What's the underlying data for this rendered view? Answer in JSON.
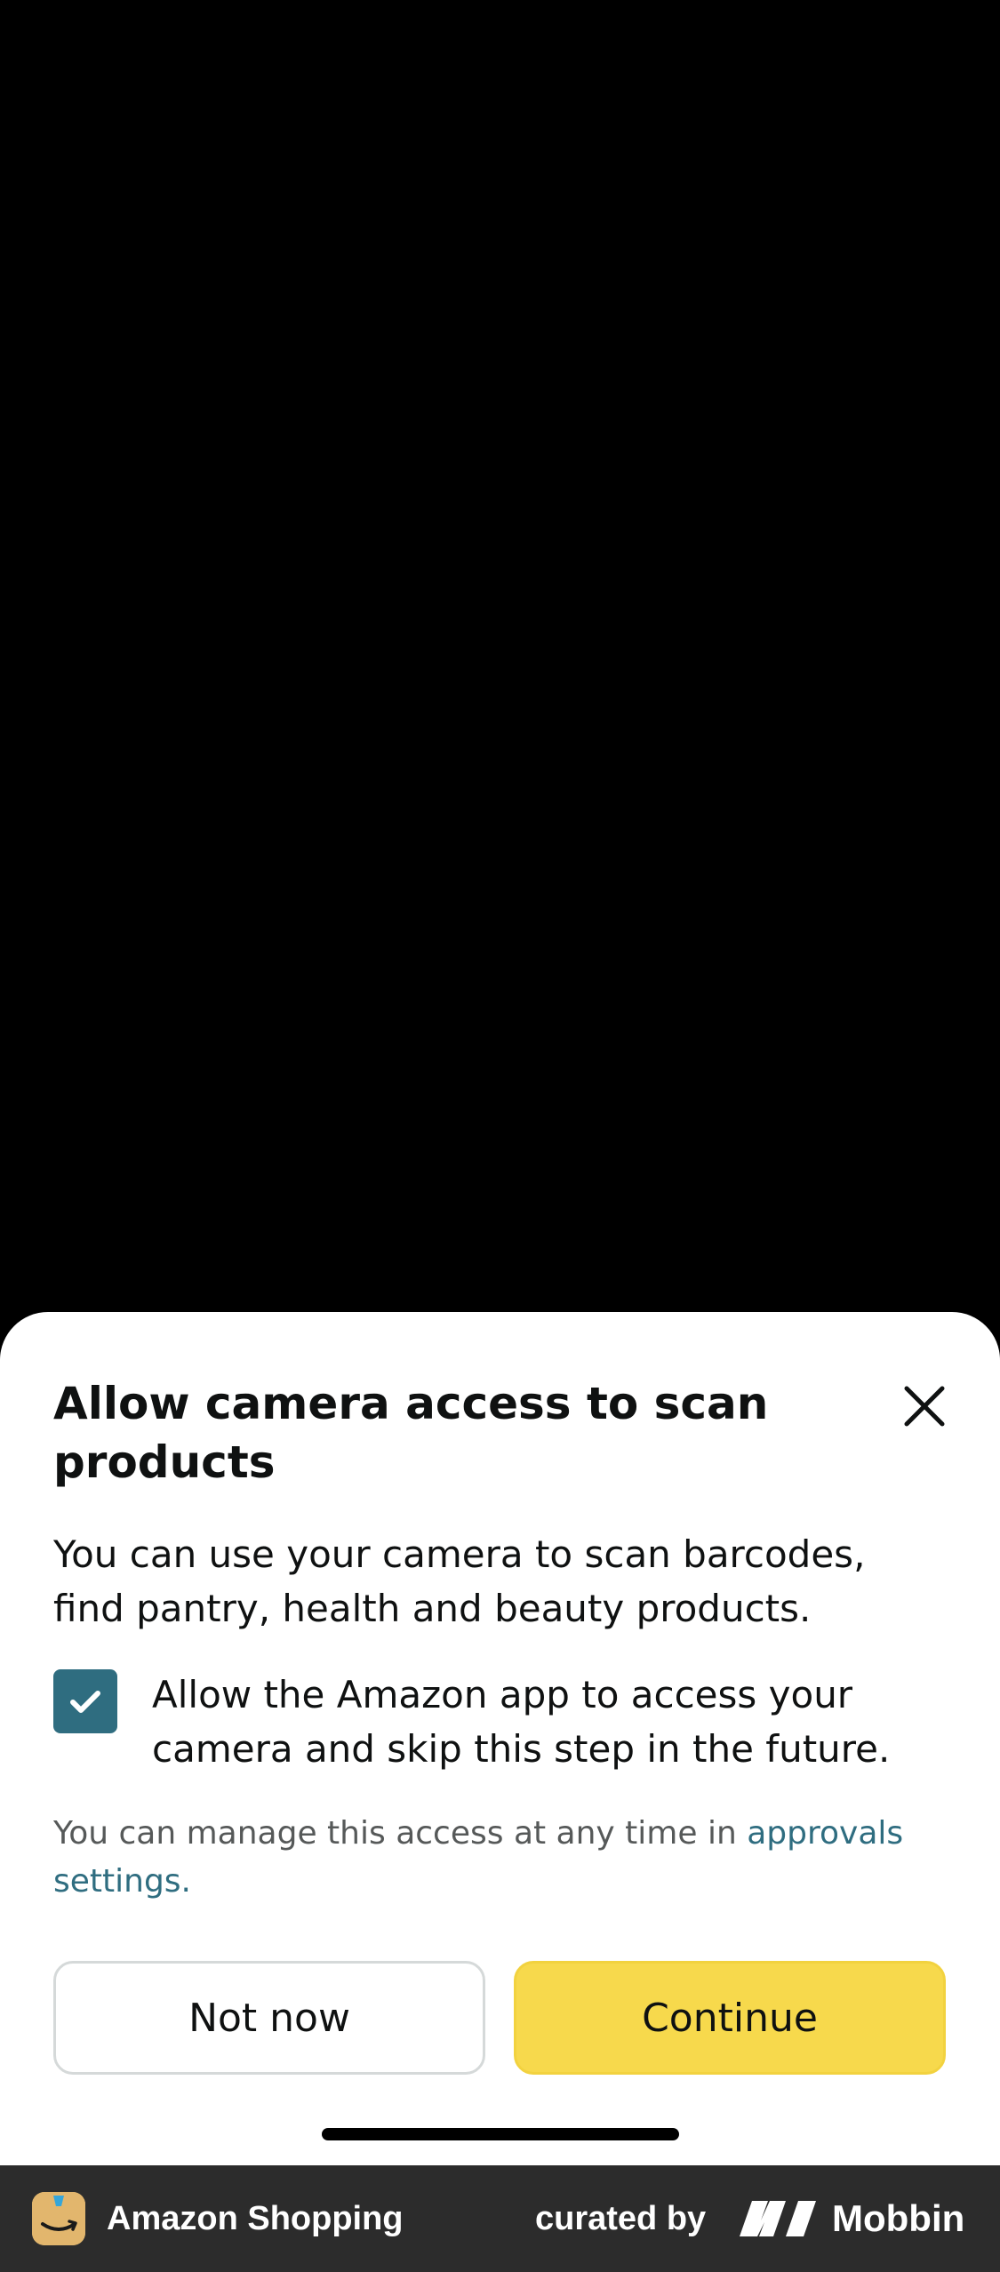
{
  "sheet": {
    "title": "Allow camera access to scan products",
    "description": "You can use your camera to scan barcodes, find pantry, health and beauty products.",
    "checkbox": {
      "checked": true,
      "label": "Allow the Amazon app to access your camera and skip this step in the future."
    },
    "manage_text": "You can manage this access at any time in ",
    "manage_link": "approvals settings.",
    "secondary_button": "Not now",
    "primary_button": "Continue",
    "colors": {
      "accent": "#2f6d80",
      "primary_button": "#f7d94c"
    }
  },
  "footer": {
    "app_name": "Amazon Shopping",
    "curated_by": "curated by",
    "brand": "Mobbin"
  },
  "icons": {
    "close": "close-icon",
    "checkbox_check": "checkmark-icon",
    "app": "amazon-app-icon",
    "brand": "mobbin-logo-icon"
  }
}
